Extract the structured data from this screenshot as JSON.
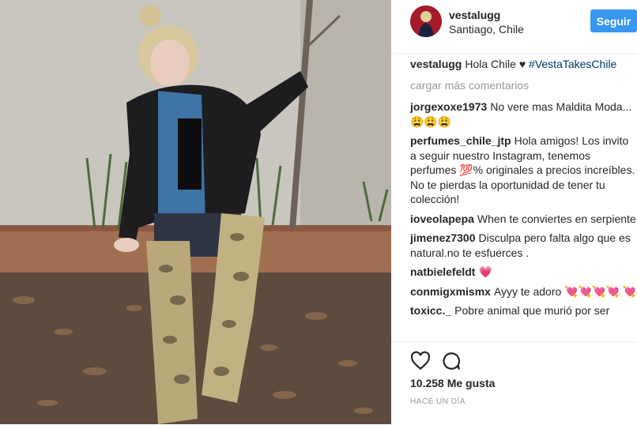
{
  "post": {
    "username": "vestalugg",
    "location": "Santiago, Chile",
    "follow_label": "Seguir",
    "caption_user": "vestalugg",
    "caption_text": "Hola Chile ♥ ",
    "caption_hashtag": "#VestaTakesChile",
    "load_more": "cargar más comentarios",
    "comments": [
      {
        "user": "jorgexoxe1973",
        "text": "No vere mas Maldita Moda...😩😩😩"
      },
      {
        "user": "perfumes_chile_jtp",
        "text": "Hola amigos! Los invito a seguir nuestro Instagram, tenemos perfumes 💯% originales a precios increíbles. No te pierdas la oportunidad de tener tu colección!"
      },
      {
        "user": "ioveolapepa",
        "text": "When te conviertes en serpiente"
      },
      {
        "user": "jimenez7300",
        "text": "Disculpa pero falta algo que es natural.no te esfuerces ."
      },
      {
        "user": "natbielefeldt",
        "text": "💗"
      },
      {
        "user": "conmigxmismx",
        "text": "Ayyy te adoro 💘💘💘💘 💘"
      },
      {
        "user": "toxicc._",
        "text": "Pobre animal que murió por ser"
      }
    ],
    "likes": "10.258 Me gusta",
    "timestamp": "HACE UN DÍA",
    "icons": {
      "like": "heart-icon",
      "comment": "comment-icon"
    },
    "colors": {
      "follow": "#3897f0",
      "hashtag": "#003569",
      "muted": "#999999"
    }
  }
}
